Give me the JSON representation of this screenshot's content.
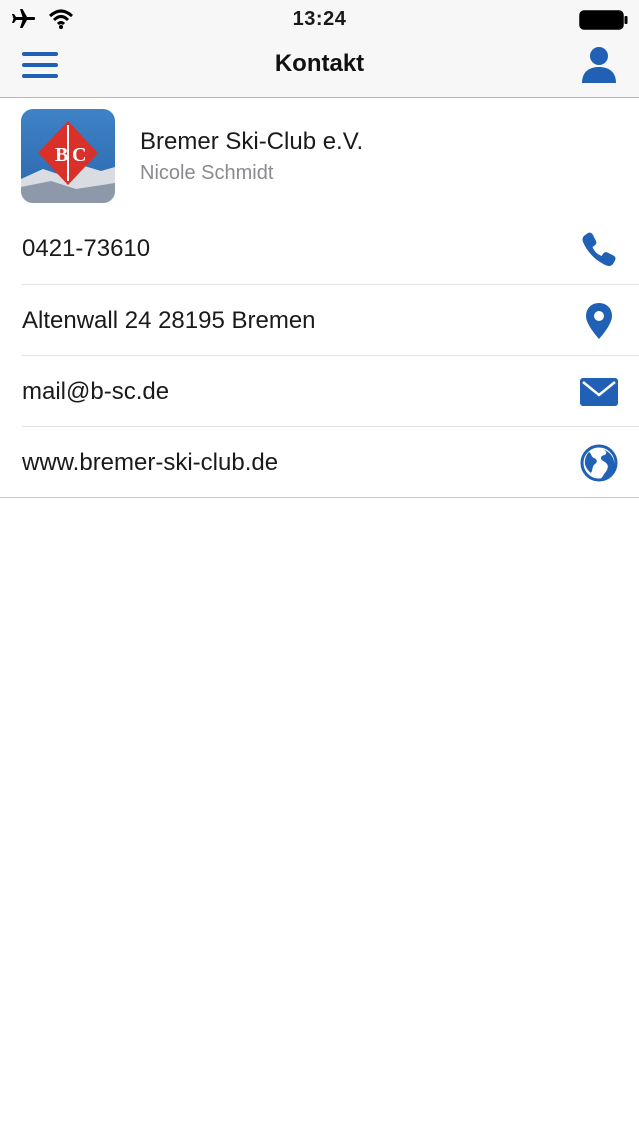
{
  "status_bar": {
    "time": "13:24",
    "icons": [
      "airplane-icon",
      "wifi-icon",
      "battery-icon"
    ]
  },
  "nav": {
    "title": "Kontakt",
    "left_icon": "hamburger-menu-icon",
    "right_icon": "person-icon"
  },
  "organization": {
    "name": "Bremer Ski-Club e.V.",
    "contact_person": "Nicole Schmidt",
    "logo_text": "B|C"
  },
  "contacts": [
    {
      "type": "phone",
      "value": "0421-73610",
      "icon": "phone-icon"
    },
    {
      "type": "address",
      "value": "Altenwall 24 28195 Bremen",
      "icon": "map-pin-icon"
    },
    {
      "type": "email",
      "value": "mail@b-sc.de",
      "icon": "mail-icon"
    },
    {
      "type": "website",
      "value": "www.bremer-ski-club.de",
      "icon": "globe-icon"
    }
  ],
  "colors": {
    "accent": "#2060b5",
    "bar_background": "#f7f7f8",
    "logo_red": "#d9312a"
  }
}
